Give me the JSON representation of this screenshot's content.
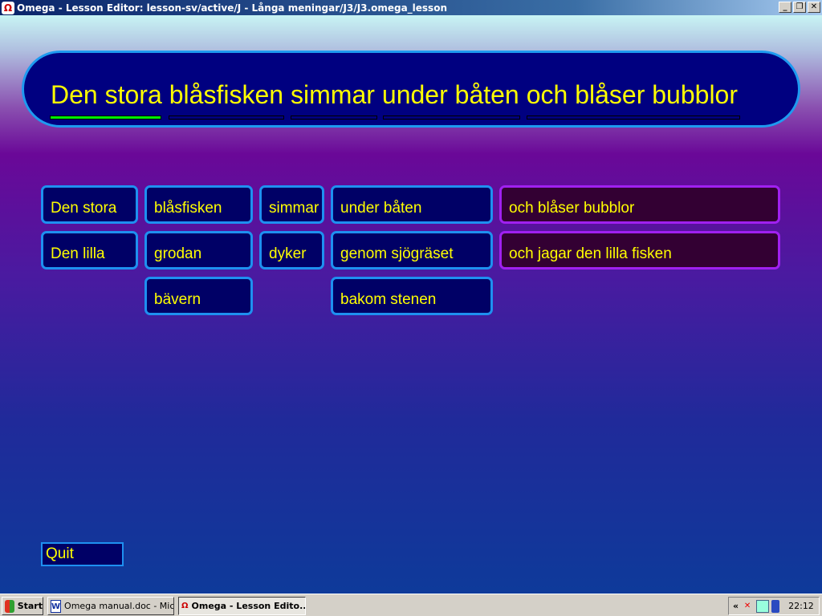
{
  "window": {
    "title": "Omega - Lesson Editor: lesson-sv/active/J - Långa meningar/J3/J3.omega_lesson",
    "buttons": [
      "_",
      "❐",
      "✕"
    ]
  },
  "sentence": {
    "words": [
      "Den stora",
      "blåsfisken",
      "simmar",
      "under båten",
      "och blåser bubblor"
    ],
    "progress_completed": 1,
    "progress_total": 5
  },
  "colors": {
    "text": "#ffff00",
    "tile_bg": "#000066",
    "tile_border": "#1e90f0",
    "end_tile_bg": "#330033",
    "end_tile_border": "#a020f0",
    "done": "#00ee00"
  },
  "columns": [
    {
      "tiles": [
        "Den stora",
        "Den lilla"
      ]
    },
    {
      "tiles": [
        "blåsfisken",
        "grodan",
        "bävern"
      ]
    },
    {
      "tiles": [
        "simmar",
        "dyker"
      ]
    },
    {
      "tiles": [
        "under båten",
        "genom sjögräset",
        "bakom stenen"
      ]
    },
    {
      "tiles": [
        "och blåser bubblor",
        "och jagar den lilla fisken"
      ]
    }
  ],
  "quit_label": "Quit",
  "taskbar": {
    "start": "Start",
    "tasks": [
      "Omega manual.doc - Mic...",
      "Omega - Lesson Edito..."
    ],
    "tray_expand": "«",
    "clock": "22:12"
  }
}
